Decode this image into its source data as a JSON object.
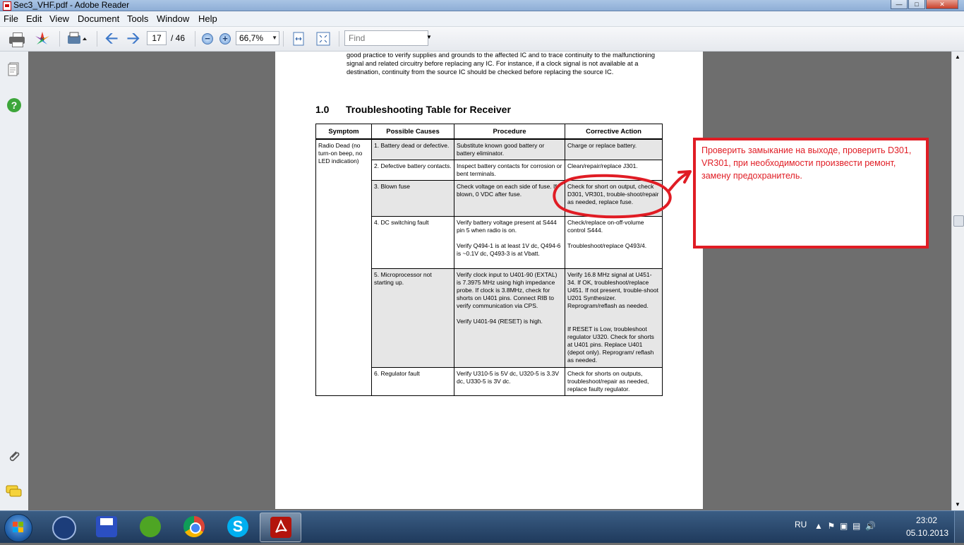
{
  "window": {
    "title": "Sec3_VHF.pdf - Adobe Reader"
  },
  "menu": [
    "File",
    "Edit",
    "View",
    "Document",
    "Tools",
    "Window",
    "Help"
  ],
  "toolbar": {
    "page_current": "17",
    "page_total": "/ 46",
    "zoom": "66,7%",
    "find_placeholder": "Find"
  },
  "document": {
    "intro_text": "good practice to verify supplies and grounds to the affected IC and to trace continuity to the malfunctioning signal and related circuitry before replacing any IC. For instance, if a clock signal is not available at a destination, continuity from the source IC should be checked before replacing the source IC.",
    "section_number": "1.0",
    "section_title": "Troubleshooting Table for Receiver",
    "table": {
      "headers": [
        "Symptom",
        "Possible Causes",
        "Procedure",
        "Corrective Action"
      ],
      "symptom": "Radio Dead (no turn-on beep, no LED indication)",
      "rows": [
        {
          "cause": "1. Battery dead or defective.",
          "procedure": "Substitute known good battery or battery eliminator.",
          "action": "Charge or replace battery."
        },
        {
          "cause": "2. Defective battery contacts.",
          "procedure": "Inspect battery contacts for corrosion or bent terminals.",
          "action": "Clean/repair/replace J301."
        },
        {
          "cause": "3. Blown fuse",
          "procedure": "Check voltage on each side of fuse. If blown, 0 VDC after fuse.",
          "action": "Check for short on output, check D301, VR301, trouble-shoot/repair as needed, replace fuse."
        },
        {
          "cause": "4. DC switching fault",
          "procedure": "Verify battery voltage present at S444 pin 5 when radio is on.",
          "procedure2": "Verify Q494-1 is at least 1V dc, Q494-6 is ~0.1V dc, Q493-3 is at Vbatt.",
          "action": "Check/replace on-off-volume control S444.",
          "action2": "Troubleshoot/replace Q493/4."
        },
        {
          "cause": "5. Microprocessor not starting up.",
          "procedure": "Verify clock input to U401-90 (EXTAL) is 7.3975 MHz using high impedance probe. If clock is 3.8MHz, check for shorts on U401 pins. Connect RIB to verify communication via CPS.",
          "procedure2": "Verify U401-94 (RESET) is high.",
          "action": "Verify 16.8 MHz signal at U451-34. If OK, troubleshoot/replace U451. If not present, trouble-shoot U201 Synthesizer. Reprogram/reflash as needed.",
          "action2": "If RESET is Low, troubleshoot regulator U320. Check for shorts at U401 pins. Replace U401 (depot only). Reprogram/ reflash as needed."
        },
        {
          "cause": "6. Regulator fault",
          "procedure": "Verify U310-5 is 5V dc, U320-5 is 3.3V dc, U330-5 is 3V dc.",
          "action": "Check for shorts on outputs, troubleshoot/repair as needed, replace faulty regulator."
        }
      ]
    }
  },
  "annotation": {
    "text": "Проверить замыкание на выходе, проверить D301, VR301, при необходимости произвести ремонт, замену предохранитель.",
    "color": "#e01c24"
  },
  "taskbar": {
    "apps": [
      "windows-start",
      "usb-utility",
      "save-app",
      "utorrent",
      "chrome",
      "skype",
      "adobe-reader"
    ],
    "language": "RU",
    "time": "23:02",
    "date": "05.10.2013"
  }
}
